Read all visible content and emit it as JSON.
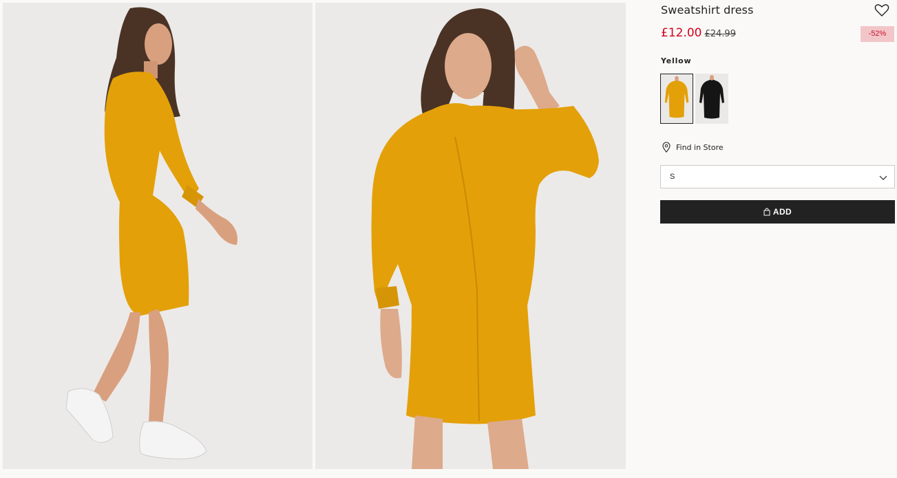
{
  "gallery": {
    "images": [
      {
        "icon": "model-side-view-image",
        "dress_color": "#e3a009"
      },
      {
        "icon": "model-front-view-image",
        "dress_color": "#e3a009"
      }
    ],
    "background": "#eceae8"
  },
  "product": {
    "title": "Sweatshirt dress",
    "price_current": "£12.00",
    "price_original": "£24.99",
    "discount_badge": "-52%",
    "favorite_icon": "heart-outline-icon",
    "color_label": "Yellow",
    "swatches": [
      {
        "color": "#e3a009",
        "selected": true
      },
      {
        "color": "#151515",
        "selected": false
      }
    ],
    "find_in_store": "Find in Store",
    "find_in_store_icon": "map-pin-icon",
    "size_value": "S",
    "size_icon": "chevron-down-icon",
    "add_label": "ADD",
    "add_icon": "shopping-bag-icon"
  },
  "colors": {
    "price_sale": "#d6001c",
    "badge_bg": "#f2c6c9",
    "button_bg": "#222222",
    "page_bg": "#faf9f8"
  }
}
